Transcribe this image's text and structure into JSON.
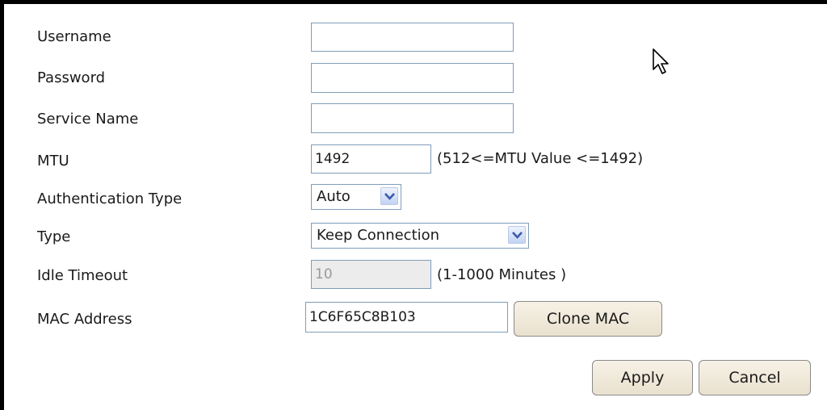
{
  "form": {
    "username": {
      "label": "Username",
      "value": ""
    },
    "password": {
      "label": "Password",
      "value": ""
    },
    "service_name": {
      "label": "Service Name",
      "value": ""
    },
    "mtu": {
      "label": "MTU",
      "value": "1492",
      "hint": "(512<=MTU Value <=1492)"
    },
    "authentication_type": {
      "label": "Authentication Type",
      "selected": "Auto"
    },
    "type": {
      "label": "Type",
      "selected": "Keep Connection"
    },
    "idle_timeout": {
      "label": "Idle Timeout",
      "value": "10",
      "hint": "(1-1000 Minutes )",
      "disabled": true
    },
    "mac_address": {
      "label": "MAC Address",
      "value": "1C6F65C8B103",
      "clone_label": "Clone MAC"
    }
  },
  "actions": {
    "apply_label": "Apply",
    "cancel_label": "Cancel"
  },
  "icons": {
    "select_arrow": "chevron-down-icon",
    "pointer": "mouse-cursor-icon"
  },
  "colors": {
    "field_border": "#7f9db9",
    "button_bg": "#f3ede0",
    "arrow_bg": "#c2d3f4",
    "disabled_bg": "#ececec"
  }
}
